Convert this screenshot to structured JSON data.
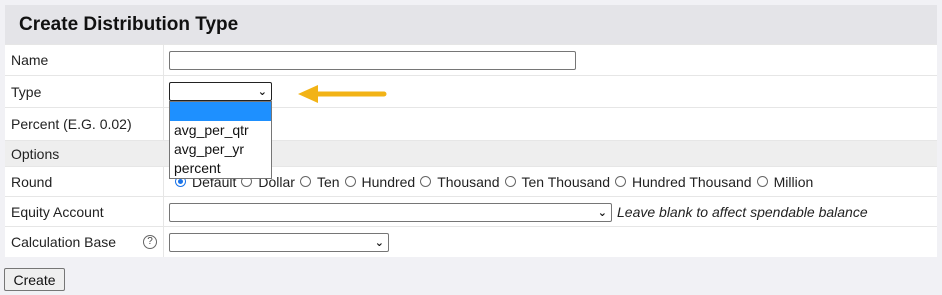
{
  "form": {
    "title": "Create Distribution Type",
    "name_label": "Name",
    "name_value": "",
    "type_label": "Type",
    "type_options": [
      "",
      "avg_per_qtr",
      "avg_per_yr",
      "percent"
    ],
    "percent_label": "Percent (E.G. 0.02)",
    "options_label": "Options",
    "round_label": "Round",
    "round_options": [
      "Default",
      "Dollar",
      "Ten",
      "Hundred",
      "Thousand",
      "Ten Thousand",
      "Hundred Thousand",
      "Million"
    ],
    "round_selected": "Default",
    "equity_label": "Equity Account",
    "equity_hint": "Leave blank to affect spendable balance",
    "calc_label": "Calculation Base",
    "help_glyph": "?",
    "create_label": "Create"
  },
  "icons": {
    "chevron": "chevron-down-icon",
    "help": "help-icon",
    "arrow": "arrow-left-icon"
  },
  "colors": {
    "arrow": "#f2b316",
    "selected_option": "#1e90ff",
    "radio_checked": "#1a73e8"
  }
}
